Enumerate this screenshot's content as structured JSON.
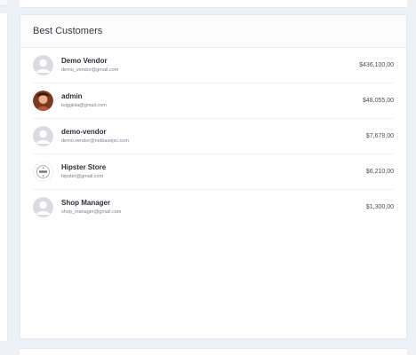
{
  "card": {
    "title": "Best Customers"
  },
  "customers": [
    {
      "name": "Demo Vendor",
      "email": "demo_vendor@gmail.com",
      "amount": "$436,100.00",
      "avatar": "default-avatar-icon"
    },
    {
      "name": "admin",
      "email": "tuiggkiia@gmail.com",
      "amount": "$48,055.00",
      "avatar": "photo-avatar"
    },
    {
      "name": "demo-vendor",
      "email": "demo.vendor@netbasejsc.com",
      "amount": "$7,678.00",
      "avatar": "default-avatar-icon"
    },
    {
      "name": "Hipster Store",
      "email": "hipster@gmail.com",
      "amount": "$6,210.00",
      "avatar": "store-logo-icon"
    },
    {
      "name": "Shop Manager",
      "email": "shop_manager@gmail.com",
      "amount": "$1,300.00",
      "avatar": "default-avatar-icon"
    }
  ],
  "colors": {
    "background": "#eef0f5",
    "card": "#ffffff",
    "avatar_default": "#d9dbe0"
  }
}
